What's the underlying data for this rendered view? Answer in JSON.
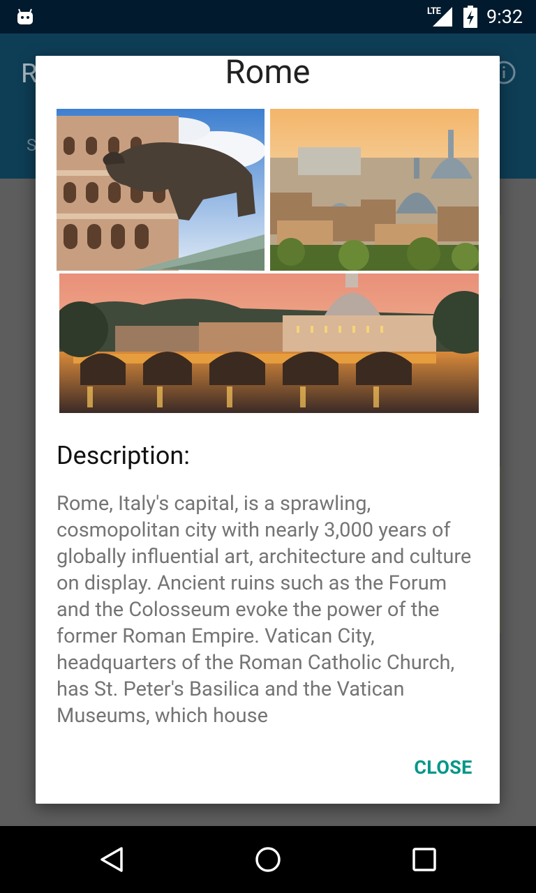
{
  "status_bar": {
    "network": "LTE",
    "time": "9:32"
  },
  "app": {
    "title_partial": "R",
    "tab_partial": "S"
  },
  "dialog": {
    "title": "Rome",
    "photos": [
      {
        "subject": "Capitoline Wolf statue in front of the Colosseum"
      },
      {
        "subject": "Rome skyline with domes at sunset"
      },
      {
        "subject": "Ponte Sant'Angelo bridge over the Tiber with St. Peter's Basilica at dusk"
      }
    ],
    "description_heading": "Description:",
    "description": "Rome, Italy's capital, is a sprawling, cosmopolitan city with nearly 3,000 years of globally influential art, architecture and culture on display. Ancient ruins such as the Forum and the Colosseum evoke the power of the former Roman Empire. Vatican City, headquarters of the Roman Catholic Church, has St. Peter's Basilica and the Vatican Museums, which house",
    "close_label": "CLOSE"
  },
  "icons": {
    "status": [
      "android-debug-icon",
      "signal-icon",
      "battery-charging-icon"
    ],
    "app": [
      "info-icon"
    ],
    "nav": [
      "back-icon",
      "home-icon",
      "recents-icon"
    ]
  },
  "colors": {
    "status_bar": "#021a2e",
    "app_bar_dimmed": "#0e3e56",
    "scrim": "#5d5d5d",
    "accent": "#009688",
    "body_text": "#747474"
  }
}
